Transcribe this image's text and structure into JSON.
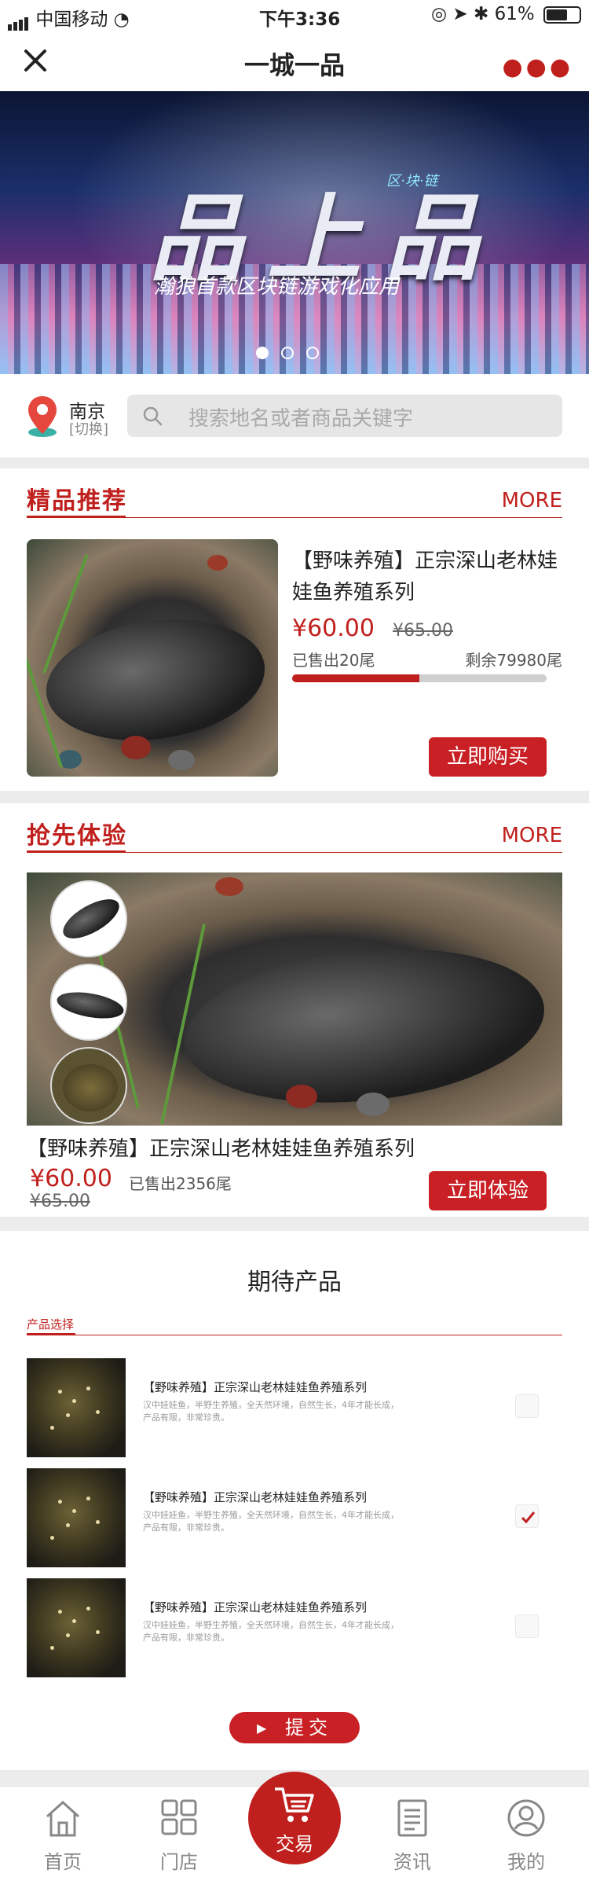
{
  "status_bar": {
    "carrier": "中国移动",
    "time": "下午3:36",
    "battery": "61%"
  },
  "nav": {
    "title": "一城一品"
  },
  "banner": {
    "headline": "品上品",
    "tagline": "区·块·链",
    "subtitle": "瀚狼首款区块链游戏化应用",
    "slide_count": 3,
    "active_slide": 1
  },
  "location": {
    "city": "南京",
    "switch_label": "[切换]"
  },
  "search": {
    "placeholder": "搜索地名或者商品关键字"
  },
  "featured": {
    "title": "精品推荐",
    "more_label": "MORE",
    "product": {
      "name": "【野味养殖】正宗深山老林娃娃鱼养殖系列",
      "price": "¥60.00",
      "old_price": "¥65.00",
      "sold": "已售出20尾",
      "remaining": "剩余79980尾",
      "progress_fraction": 0.5,
      "buy_label": "立即购买"
    }
  },
  "trial": {
    "title": "抢先体验",
    "more_label": "MORE",
    "product": {
      "name": "【野味养殖】正宗深山老林娃娃鱼养殖系列",
      "price": "¥60.00",
      "old_price": "¥65.00",
      "sold": "已售出2356尾",
      "try_label": "立即体验"
    }
  },
  "expected": {
    "title": "期待产品",
    "tab_label": "产品选择",
    "items": [
      {
        "name": "【野味养殖】正宗深山老林娃娃鱼养殖系列",
        "desc": "汉中娃娃鱼，半野生养殖，全天然环境，自然生长，4年才能长成，产品有限，非常珍贵。",
        "checked": false
      },
      {
        "name": "【野味养殖】正宗深山老林娃娃鱼养殖系列",
        "desc": "汉中娃娃鱼，半野生养殖，全天然环境，自然生长，4年才能长成，产品有限，非常珍贵。",
        "checked": true
      },
      {
        "name": "【野味养殖】正宗深山老林娃娃鱼养殖系列",
        "desc": "汉中娃娃鱼，半野生养殖，全天然环境，自然生长，4年才能长成，产品有限，非常珍贵。",
        "checked": false
      }
    ],
    "submit_label": "提交"
  },
  "tabbar": {
    "items": [
      {
        "label": "首页",
        "icon": "home-icon"
      },
      {
        "label": "门店",
        "icon": "grid-icon"
      },
      {
        "label": "交易",
        "icon": "cart-icon"
      },
      {
        "label": "资讯",
        "icon": "news-icon"
      },
      {
        "label": "我的",
        "icon": "user-icon"
      }
    ]
  },
  "colors": {
    "accent": "#c0201d",
    "button": "#c82025",
    "background": "#ececec"
  }
}
